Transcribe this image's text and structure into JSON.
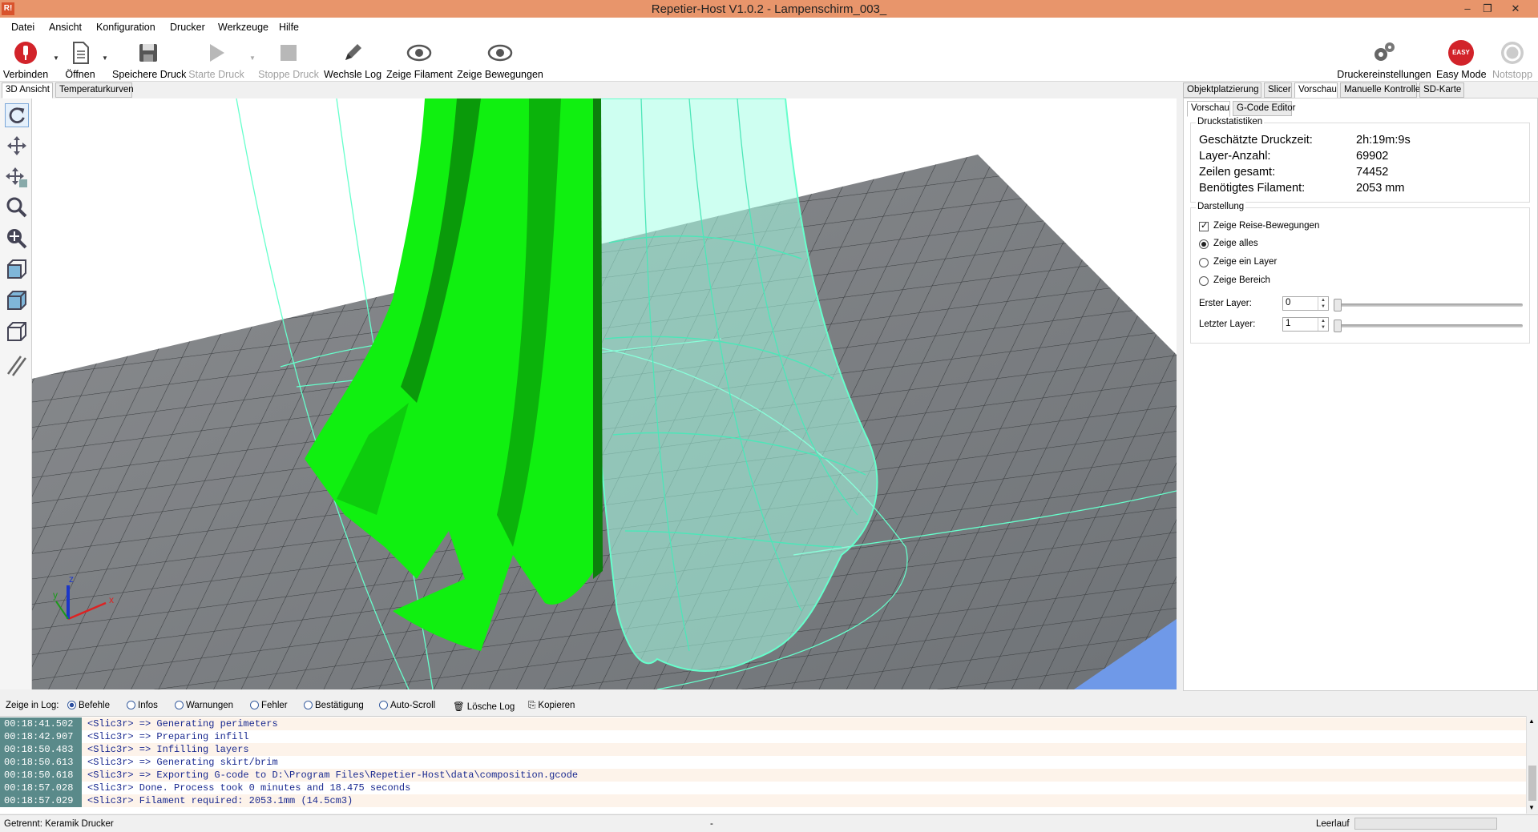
{
  "window": {
    "title": "Repetier-Host V1.0.2 - Lampenschirm_003_",
    "app_icon": "R!",
    "min": "–",
    "max": "❐",
    "close": "✕"
  },
  "menu": [
    "Datei",
    "Ansicht",
    "Konfiguration",
    "Drucker",
    "Werkzeuge",
    "Hilfe"
  ],
  "toolbar": {
    "connect": "Verbinden",
    "open": "Öffnen",
    "save_print": "Speichere Druck",
    "start_print": "Starte Druck",
    "stop_print": "Stoppe Druck",
    "toggle_log": "Wechsle Log",
    "show_filament": "Zeige Filament",
    "show_moves": "Zeige Bewegungen",
    "printer_settings": "Druckereinstellungen",
    "easy_mode": "Easy Mode",
    "easy_badge": "EASY",
    "emergency_stop": "Notstopp"
  },
  "left_tabs": [
    "3D Ansicht",
    "Temperaturkurven"
  ],
  "right_tabs": [
    "Objektplatzierung",
    "Slicer",
    "Vorschau",
    "Manuelle Kontrolle",
    "SD-Karte"
  ],
  "sub_tabs": [
    "Vorschau",
    "G-Code Editor"
  ],
  "stats": {
    "group_title": "Druckstatistiken",
    "rows": [
      {
        "label": "Geschätzte Druckzeit:",
        "value": "2h:19m:9s"
      },
      {
        "label": "Layer-Anzahl:",
        "value": "69902"
      },
      {
        "label": "Zeilen gesamt:",
        "value": "74452"
      },
      {
        "label": "Benötigtes Filament:",
        "value": "2053 mm"
      }
    ]
  },
  "display": {
    "group_title": "Darstellung",
    "show_travel": "Zeige Reise-Bewegungen",
    "show_all": "Zeige alles",
    "show_one_layer": "Zeige ein Layer",
    "show_range": "Zeige Bereich",
    "first_layer_label": "Erster Layer:",
    "first_layer_value": "0",
    "last_layer_label": "Letzter Layer:",
    "last_layer_value": "1"
  },
  "logbar": {
    "label": "Zeige in Log:",
    "commands": "Befehle",
    "infos": "Infos",
    "warnings": "Warnungen",
    "errors": "Fehler",
    "confirmations": "Bestätigung",
    "autoscroll": "Auto-Scroll",
    "clear": "Lösche Log",
    "copy": "Kopieren"
  },
  "log": [
    {
      "time": "00:18:41.502",
      "msg": "<Slic3r> => Generating perimeters"
    },
    {
      "time": "00:18:42.907",
      "msg": "<Slic3r> => Preparing infill"
    },
    {
      "time": "00:18:50.483",
      "msg": "<Slic3r> => Infilling layers"
    },
    {
      "time": "00:18:50.613",
      "msg": "<Slic3r> => Generating skirt/brim"
    },
    {
      "time": "00:18:50.618",
      "msg": "<Slic3r> => Exporting G-code to D:\\Program Files\\Repetier-Host\\data\\composition.gcode"
    },
    {
      "time": "00:18:57.028",
      "msg": "<Slic3r> Done. Process took 0 minutes and 18.475 seconds"
    },
    {
      "time": "00:18:57.029",
      "msg": "<Slic3r> Filament required: 2053.1mm (14.5cm3)"
    }
  ],
  "status": {
    "left": "Getrennt: Keramik Drucker",
    "center": "-",
    "right": "Leerlauf"
  },
  "axes": {
    "x": "x",
    "y": "y",
    "z": "z"
  },
  "colors": {
    "model": "#00ee00",
    "toolpath": "#66ffcc",
    "bed": "#7a7d80"
  }
}
